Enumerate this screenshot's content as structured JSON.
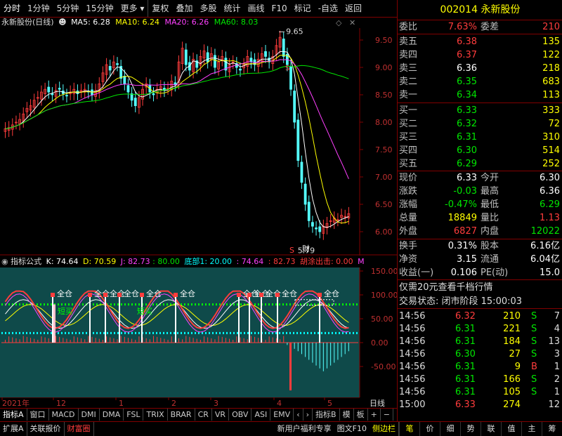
{
  "toolbar": {
    "items": [
      "分时",
      "1分钟",
      "5分钟",
      "15分钟",
      "更多",
      "复权",
      "叠加",
      "多股",
      "统计",
      "画线",
      "F10",
      "标记",
      "-自选",
      "返回"
    ]
  },
  "chart": {
    "stock_label": "永新股份(日线)",
    "ma5": "MA5: 6.28",
    "ma10": "MA10: 6.24",
    "ma20": "MA20: 6.26",
    "ma60": "MA60: 8.03",
    "high_mark": "9.65",
    "low_mark": "5.79",
    "price_ticks": [
      "9.50",
      "9.00",
      "8.50",
      "8.00",
      "7.50",
      "7.00",
      "6.50",
      "6.00"
    ],
    "marker_s": "S",
    "marker_cai": "财"
  },
  "indicator": {
    "name": "指标公式",
    "k": "K: 74.64",
    "d": "D: 70.59",
    "j": "J: 82.73",
    "v80": ": 80.00",
    "bottom": "底部1: 20.00",
    "v2": ": 74.64",
    "v3": ": 82.73",
    "sell": "胡涂出击: 0.00",
    "m": "M",
    "ticks": [
      "150.00",
      "100.00",
      "50.00",
      "0.00",
      "-50.00"
    ],
    "labels_full": "全仓",
    "labels_short": "短买"
  },
  "xaxis": {
    "labels": [
      "2021年",
      "12",
      "1",
      "2",
      "3",
      "4",
      "5"
    ],
    "right": "日线"
  },
  "tabs": [
    "指标A",
    "窗口",
    "MACD",
    "DMI",
    "DMA",
    "FSL",
    "TRIX",
    "BRAR",
    "CR",
    "VR",
    "OBV",
    "ASI",
    "EMV",
    "‹",
    "›",
    "指标B",
    "模",
    "板",
    "+",
    "−"
  ],
  "status": {
    "items": [
      "扩展A",
      "关联报价",
      "财富圈"
    ],
    "promo": "新用户福利专享",
    "f10": "图文F10",
    "side": "侧边栏",
    "right_tabs": [
      "笔",
      "价",
      "细",
      "势",
      "联",
      "值",
      "主",
      "筹"
    ]
  },
  "quote": {
    "code": "002014",
    "name": "永新股份",
    "weibi_label": "委比",
    "weibi": "7.63%",
    "weicha_label": "委差",
    "weicha": "210",
    "sells": [
      {
        "label": "卖五",
        "price": "6.38",
        "vol": "135"
      },
      {
        "label": "卖四",
        "price": "6.37",
        "vol": "122"
      },
      {
        "label": "卖三",
        "price": "6.36",
        "vol": "218"
      },
      {
        "label": "卖二",
        "price": "6.35",
        "vol": "683"
      },
      {
        "label": "卖一",
        "price": "6.34",
        "vol": "113"
      }
    ],
    "buys": [
      {
        "label": "买一",
        "price": "6.33",
        "vol": "333"
      },
      {
        "label": "买二",
        "price": "6.32",
        "vol": "72"
      },
      {
        "label": "买三",
        "price": "6.31",
        "vol": "310"
      },
      {
        "label": "买四",
        "price": "6.30",
        "vol": "514"
      },
      {
        "label": "买五",
        "price": "6.29",
        "vol": "252"
      }
    ],
    "stats": [
      {
        "l1": "现价",
        "v1": "6.33",
        "l2": "今开",
        "v2": "6.30"
      },
      {
        "l1": "涨跌",
        "v1": "-0.03",
        "l2": "最高",
        "v2": "6.36"
      },
      {
        "l1": "涨幅",
        "v1": "-0.47%",
        "l2": "最低",
        "v2": "6.29"
      },
      {
        "l1": "总量",
        "v1": "18849",
        "l2": "量比",
        "v2": "1.13"
      },
      {
        "l1": "外盘",
        "v1": "6827",
        "l2": "内盘",
        "v2": "12022"
      }
    ],
    "stats2": [
      {
        "l1": "换手",
        "v1": "0.31%",
        "l2": "股本",
        "v2": "6.16亿"
      },
      {
        "l1": "净资",
        "v1": "3.15",
        "l2": "流通",
        "v2": "6.04亿"
      },
      {
        "l1": "收益(一)",
        "v1": "0.106",
        "l2": "PE(动)",
        "v2": "15.0"
      }
    ],
    "promo": "仅需20元查看千档行情",
    "trade_state": "交易状态: 闭市阶段 15:00:03",
    "ticks": [
      {
        "t": "14:56",
        "p": "6.32",
        "v": "210",
        "d": "S",
        "n": "7"
      },
      {
        "t": "14:56",
        "p": "6.31",
        "v": "221",
        "d": "S",
        "n": "4"
      },
      {
        "t": "14:56",
        "p": "6.31",
        "v": "184",
        "d": "S",
        "n": "13"
      },
      {
        "t": "14:56",
        "p": "6.30",
        "v": "27",
        "d": "S",
        "n": "3"
      },
      {
        "t": "14:56",
        "p": "6.31",
        "v": "9",
        "d": "B",
        "n": "1"
      },
      {
        "t": "14:56",
        "p": "6.31",
        "v": "166",
        "d": "S",
        "n": "2"
      },
      {
        "t": "14:56",
        "p": "6.31",
        "v": "105",
        "d": "S",
        "n": "1"
      },
      {
        "t": "15:00",
        "p": "6.33",
        "v": "274",
        "d": "",
        "n": "12"
      }
    ]
  }
}
